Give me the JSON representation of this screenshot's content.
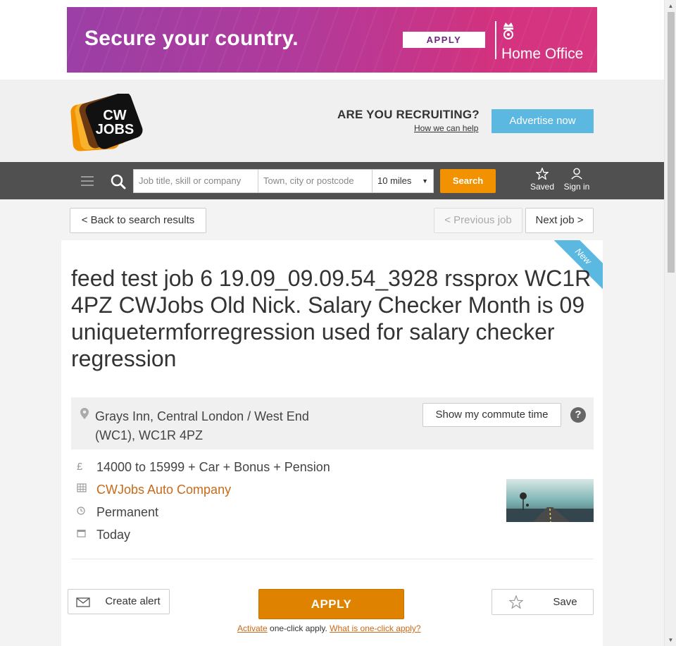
{
  "ad": {
    "headline": "Secure your country.",
    "apply_label": "APPLY",
    "brand": "Home Office"
  },
  "header": {
    "logo_line1": "CW",
    "logo_line2": "JOBS",
    "recruit_title": "ARE YOU RECRUITING?",
    "recruit_link": "How we can help",
    "advertise_label": "Advertise now"
  },
  "search": {
    "job_placeholder": "Job title, skill or company",
    "location_placeholder": "Town, city or postcode",
    "radius": "10 miles",
    "button_label": "Search",
    "saved_label": "Saved",
    "signin_label": "Sign in"
  },
  "nav": {
    "back_label": "< Back to search results",
    "prev_label": "< Previous job",
    "next_label": "Next job >"
  },
  "job": {
    "badge": "New",
    "title": "feed test job 6 19.09_09.09.54_3928 rssprox WC1R 4PZ CWJobs Old Nick. Salary Checker Month is 09 uniquetermforregression used for salary checker regression",
    "location": "Grays Inn, Central London / West End (WC1), WC1R 4PZ",
    "commute_label": "Show my commute time",
    "help_label": "?",
    "salary_icon": "£",
    "salary": "14000 to 15999 + Car + Bonus + Pension",
    "company": "CWJobs Auto Company",
    "type": "Permanent",
    "posted": "Today"
  },
  "actions": {
    "create_alert_label": "Create alert",
    "apply_label": "APPLY",
    "save_label": "Save",
    "activate_link": "Activate",
    "oneclick_text": " one-click apply. ",
    "oneclick_link": "What is one-click apply?"
  },
  "colors": {
    "accent_orange": "#f39200",
    "apply_orange": "#de8200",
    "advertise_blue": "#5bb8e0",
    "searchbar_bg": "#505050",
    "company_link": "#c86a1a"
  }
}
